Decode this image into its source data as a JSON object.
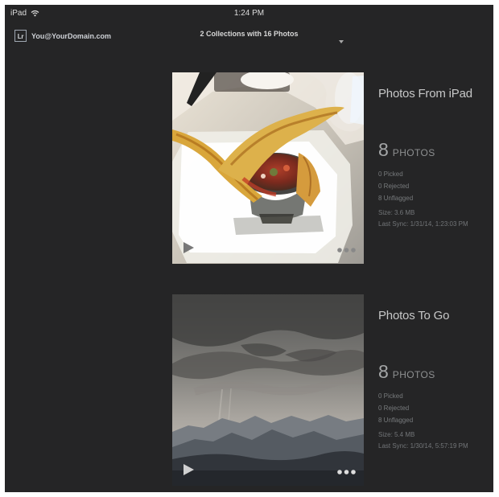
{
  "status_bar": {
    "device": "iPad",
    "time": "1:24 PM",
    "wifi_icon": "wifi-icon"
  },
  "header": {
    "logo_text": "Lr",
    "account": "You@YourDomain.com",
    "summary": "2 Collections with 16 Photos",
    "summary_icon": "chevron-down-icon"
  },
  "collections": [
    {
      "name": "Photos From iPad",
      "count": "8",
      "count_label": "PHOTOS",
      "picked": "0 Picked",
      "rejected": "0 Rejected",
      "unflagged": "8 Unflagged",
      "size": "Size: 3.6 MB",
      "last_sync": "Last Sync: 1/31/14, 1:23:03 PM",
      "thumbnail": "food-photo",
      "play_icon": "play-icon",
      "more_icon": "more-icon"
    },
    {
      "name": "Photos To Go",
      "count": "8",
      "count_label": "PHOTOS",
      "picked": "0 Picked",
      "rejected": "0 Rejected",
      "unflagged": "8 Unflagged",
      "size": "Size: 5.4 MB",
      "last_sync": "Last Sync: 1/30/14, 5:57:19 PM",
      "thumbnail": "mountain-landscape-photo",
      "play_icon": "play-icon",
      "more_icon": "more-icon"
    }
  ]
}
